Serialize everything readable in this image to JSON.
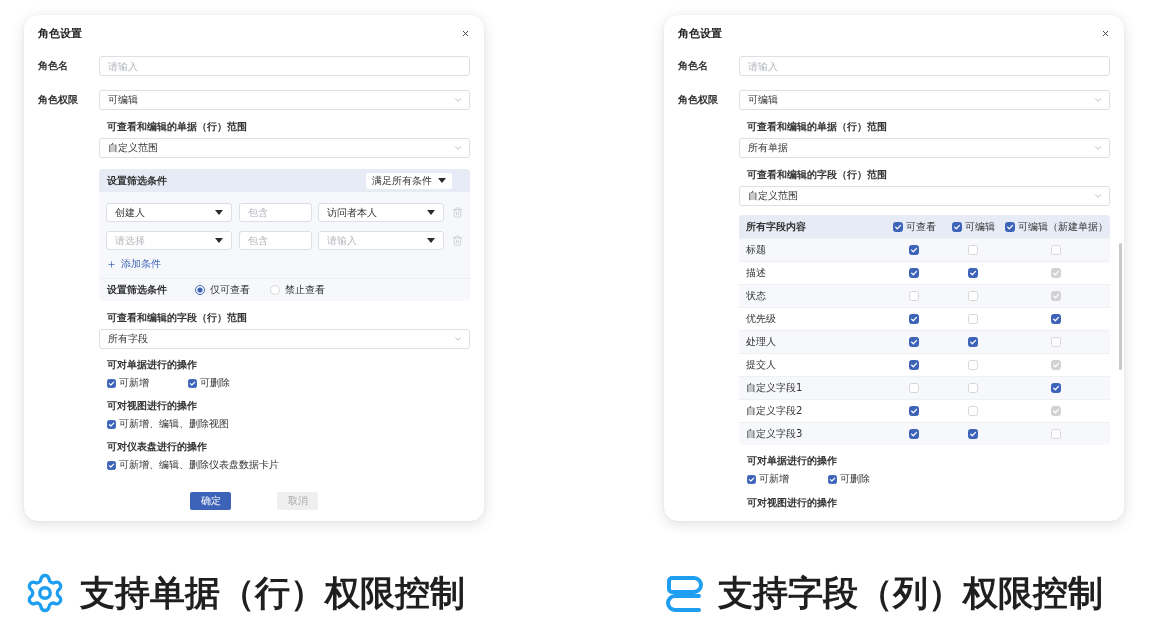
{
  "panels": [
    {
      "dialog": {
        "title": "角色设置",
        "sections": [
          {
            "kind": "text_field",
            "label": "角色名",
            "placeholder": "请输入"
          },
          {
            "kind": "select_field",
            "label": "角色权限",
            "value": "可编辑"
          },
          {
            "kind": "subheading",
            "text": "可查看和编辑的单据（行）范围"
          },
          {
            "kind": "select",
            "value": "自定义范围"
          },
          {
            "kind": "filter_panel",
            "title": "设置筛选条件",
            "match": "满足所有条件",
            "conditions": [
              {
                "field": {
                  "value": "创建人"
                },
                "operator": {
                  "placeholder": "包含"
                },
                "target": {
                  "value": "访问者本人"
                }
              },
              {
                "field": {
                  "placeholder": "请选择"
                },
                "operator": {
                  "placeholder": "包含"
                },
                "target": {
                  "placeholder": "请输入"
                }
              }
            ],
            "add_label": "添加条件",
            "visibility": {
              "label": "设置筛选条件",
              "options": [
                {
                  "label": "仅可查看",
                  "selected": true
                },
                {
                  "label": "禁止查看",
                  "selected": false
                }
              ]
            }
          },
          {
            "kind": "subheading",
            "text": "可查看和编辑的字段（行）范围"
          },
          {
            "kind": "select",
            "value": "所有字段"
          },
          {
            "kind": "checkbox_group",
            "title": "可对单据进行的操作",
            "options": [
              {
                "label": "可新增",
                "checked": true
              },
              {
                "label": "可删除",
                "checked": true
              }
            ]
          },
          {
            "kind": "checkbox_group",
            "title": "可对视图进行的操作",
            "options": [
              {
                "label": "可新增、编辑、删除视图",
                "checked": true
              }
            ]
          },
          {
            "kind": "checkbox_group",
            "title": "可对仪表盘进行的操作",
            "options": [
              {
                "label": "可新增、编辑、删除仪表盘数据卡片",
                "checked": true
              }
            ]
          }
        ],
        "buttons": [
          {
            "label": "确定",
            "primary": true
          },
          {
            "label": "取消",
            "primary": false
          }
        ]
      },
      "caption": "支持单据（行）权限控制"
    },
    {
      "dialog": {
        "title": "角色设置",
        "sections": [
          {
            "kind": "text_field",
            "label": "角色名",
            "placeholder": "请输入"
          },
          {
            "kind": "select_field",
            "label": "角色权限",
            "value": "可编辑"
          },
          {
            "kind": "subheading",
            "text": "可查看和编辑的单据（行）范围"
          },
          {
            "kind": "select",
            "value": "所有单据"
          },
          {
            "kind": "subheading",
            "text": "可查看和编辑的字段（行）范围"
          },
          {
            "kind": "select",
            "value": "自定义范围"
          },
          {
            "kind": "field_table",
            "name_header": "所有字段内容",
            "columns": [
              {
                "label": "可查看",
                "checked": true
              },
              {
                "label": "可编辑",
                "checked": true
              },
              {
                "label": "可编辑（新建单据）",
                "checked": true
              }
            ],
            "rows": [
              {
                "name": "标题",
                "cells": [
                  {
                    "checked": true,
                    "disabled": false
                  },
                  {
                    "checked": false,
                    "disabled": false
                  },
                  {
                    "checked": false,
                    "disabled": false
                  }
                ]
              },
              {
                "name": "描述",
                "cells": [
                  {
                    "checked": true,
                    "disabled": false
                  },
                  {
                    "checked": true,
                    "disabled": false
                  },
                  {
                    "checked": true,
                    "disabled": true
                  }
                ]
              },
              {
                "name": "状态",
                "cells": [
                  {
                    "checked": false,
                    "disabled": false
                  },
                  {
                    "checked": false,
                    "disabled": false
                  },
                  {
                    "checked": true,
                    "disabled": true
                  }
                ]
              },
              {
                "name": "优先级",
                "cells": [
                  {
                    "checked": true,
                    "disabled": false
                  },
                  {
                    "checked": false,
                    "disabled": false
                  },
                  {
                    "checked": true,
                    "disabled": false
                  }
                ]
              },
              {
                "name": "处理人",
                "cells": [
                  {
                    "checked": true,
                    "disabled": false
                  },
                  {
                    "checked": true,
                    "disabled": false
                  },
                  {
                    "checked": false,
                    "disabled": false
                  }
                ]
              },
              {
                "name": "提交人",
                "cells": [
                  {
                    "checked": true,
                    "disabled": false
                  },
                  {
                    "checked": false,
                    "disabled": false
                  },
                  {
                    "checked": true,
                    "disabled": true
                  }
                ]
              },
              {
                "name": "自定义字段1",
                "cells": [
                  {
                    "checked": false,
                    "disabled": false
                  },
                  {
                    "checked": false,
                    "disabled": false
                  },
                  {
                    "checked": true,
                    "disabled": false
                  }
                ]
              },
              {
                "name": "自定义字段2",
                "cells": [
                  {
                    "checked": true,
                    "disabled": false
                  },
                  {
                    "checked": false,
                    "disabled": false
                  },
                  {
                    "checked": true,
                    "disabled": true
                  }
                ]
              },
              {
                "name": "自定义字段3",
                "cells": [
                  {
                    "checked": true,
                    "disabled": false
                  },
                  {
                    "checked": true,
                    "disabled": false
                  },
                  {
                    "checked": false,
                    "disabled": false
                  }
                ]
              }
            ]
          },
          {
            "kind": "checkbox_group",
            "title": "可对单据进行的操作",
            "options": [
              {
                "label": "可新增",
                "checked": true
              },
              {
                "label": "可删除",
                "checked": true
              }
            ]
          },
          {
            "kind": "subheading",
            "text": "可对视图进行的操作"
          }
        ]
      },
      "caption": "支持字段（列）权限控制"
    }
  ]
}
